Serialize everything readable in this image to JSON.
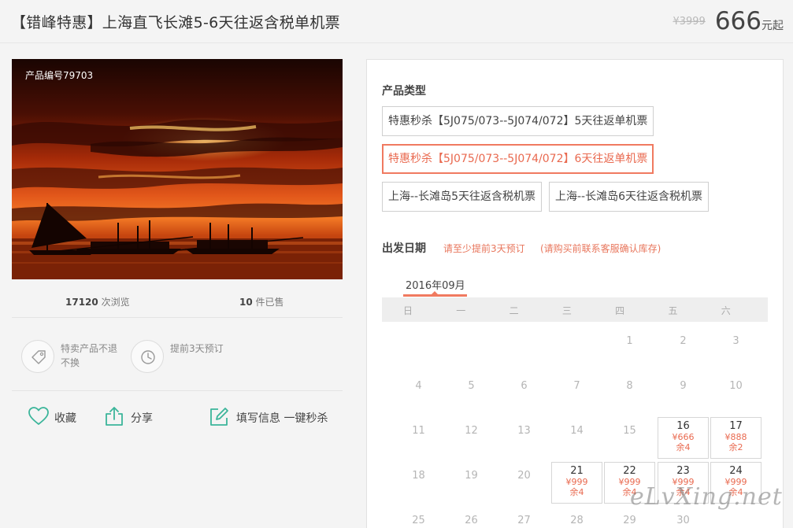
{
  "header": {
    "title": "【错峰特惠】上海直飞长滩5-6天往返含税单机票",
    "old_price": "¥3999",
    "price": "666",
    "price_suffix": "元起"
  },
  "product": {
    "number_label": "产品编号79703",
    "views_count": "17120",
    "views_label": "次浏览",
    "sold_count": "10",
    "sold_label": "件已售"
  },
  "policies": [
    {
      "icon": "tag-icon",
      "text": "特卖产品不退不换"
    },
    {
      "icon": "clock-icon",
      "text": "提前3天预订"
    }
  ],
  "actions": {
    "favorite": "收藏",
    "share": "分享",
    "fill_info": "填写信息 一键秒杀"
  },
  "product_type": {
    "title": "产品类型",
    "options": [
      {
        "label": "特惠秒杀【5J075/073--5J074/072】5天往返单机票",
        "selected": false
      },
      {
        "label": "特惠秒杀【5J075/073--5J074/072】6天往返单机票",
        "selected": true
      },
      {
        "label": "上海--长滩岛5天往返含税机票",
        "selected": false
      },
      {
        "label": "上海--长滩岛6天往返含税机票",
        "selected": false
      }
    ]
  },
  "departure": {
    "title": "出发日期",
    "note1": "请至少提前3天预订",
    "note2": "(请购买前联系客服确认库存)",
    "month": "2016年09月",
    "weekdays": [
      "日",
      "一",
      "二",
      "三",
      "四",
      "五",
      "六"
    ],
    "rows": [
      [
        null,
        null,
        null,
        null,
        {
          "d": "1"
        },
        {
          "d": "2"
        },
        {
          "d": "3"
        }
      ],
      [
        {
          "d": "4"
        },
        {
          "d": "5"
        },
        {
          "d": "6"
        },
        {
          "d": "7"
        },
        {
          "d": "8"
        },
        {
          "d": "9"
        },
        {
          "d": "10"
        }
      ],
      [
        {
          "d": "11"
        },
        {
          "d": "12"
        },
        {
          "d": "13"
        },
        {
          "d": "14"
        },
        {
          "d": "15"
        },
        {
          "d": "16",
          "p": "¥666",
          "s": "余4"
        },
        {
          "d": "17",
          "p": "¥888",
          "s": "余2"
        }
      ],
      [
        {
          "d": "18"
        },
        {
          "d": "19"
        },
        {
          "d": "20"
        },
        {
          "d": "21",
          "p": "¥999",
          "s": "余4"
        },
        {
          "d": "22",
          "p": "¥999",
          "s": "余4"
        },
        {
          "d": "23",
          "p": "¥999",
          "s": "余4"
        },
        {
          "d": "24",
          "p": "¥999",
          "s": "余4"
        }
      ],
      [
        {
          "d": "25"
        },
        {
          "d": "26"
        },
        {
          "d": "27"
        },
        {
          "d": "28"
        },
        {
          "d": "29"
        },
        {
          "d": "30"
        },
        null
      ]
    ]
  },
  "watermark": "eLvXing.net",
  "colors": {
    "accent": "#f07a60",
    "accent_text": "#e9694f",
    "icon_green": "#3bb59a"
  }
}
